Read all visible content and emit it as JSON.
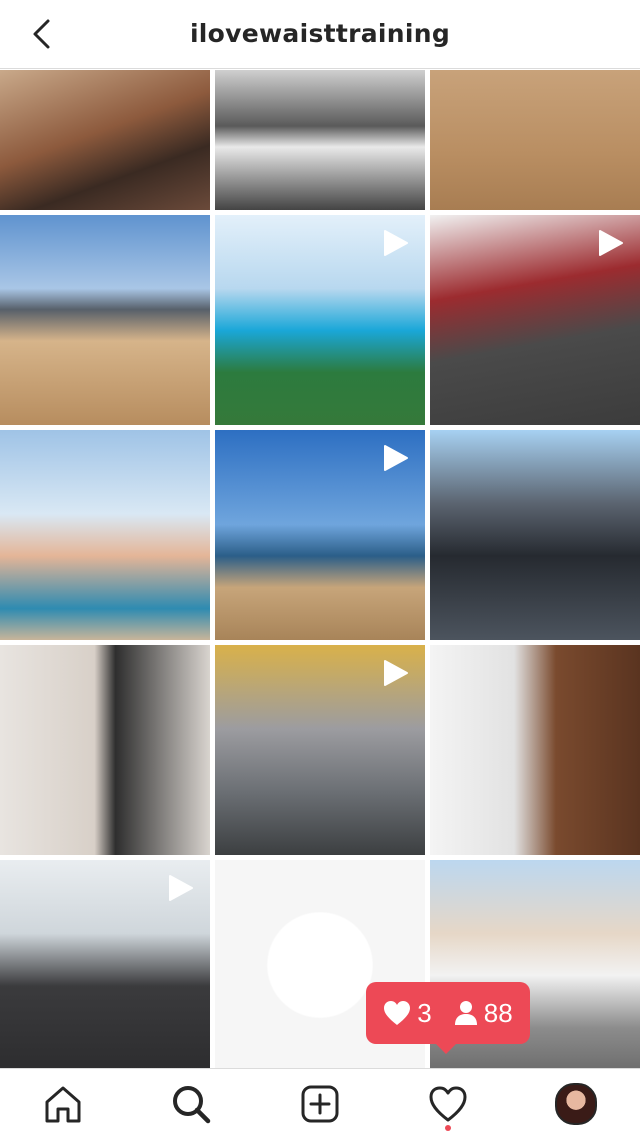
{
  "header": {
    "title": "ilovewaisttraining",
    "back_icon": "chevron-left-icon"
  },
  "grid": {
    "tiles": [
      {
        "subject": "woman doing ab crunch on mat",
        "video": false
      },
      {
        "subject": "woman in white leggings in gym",
        "video": false
      },
      {
        "subject": "woman walking dog on beach",
        "video": false
      },
      {
        "subject": "woman posing on beach",
        "video": false
      },
      {
        "subject": "two women in yellow swimsuits by pool",
        "video": true
      },
      {
        "subject": "man on incline bench in gym",
        "video": true
      },
      {
        "subject": "woman with hula hoops on beach",
        "video": false
      },
      {
        "subject": "woman standing on beach",
        "video": true
      },
      {
        "subject": "man driving car",
        "video": false
      },
      {
        "subject": "woman mirror selfie",
        "video": false
      },
      {
        "subject": "woman with exercise ball in gym",
        "video": true
      },
      {
        "subject": "woman in pink shorts and waist trainer",
        "video": false
      },
      {
        "subject": "woman doing floor exercise",
        "video": true
      },
      {
        "subject": "white tank top product",
        "video": false
      },
      {
        "subject": "woman posing by white car",
        "video": false
      }
    ]
  },
  "notification": {
    "likes_count": "3",
    "followers_count": "88",
    "like_icon": "heart-filled-icon",
    "follower_icon": "person-icon"
  },
  "tabbar": {
    "items": [
      "home-icon",
      "search-icon",
      "add-post-icon",
      "activity-heart-icon",
      "profile-avatar"
    ],
    "active": "search",
    "accent": "#ed4956"
  }
}
